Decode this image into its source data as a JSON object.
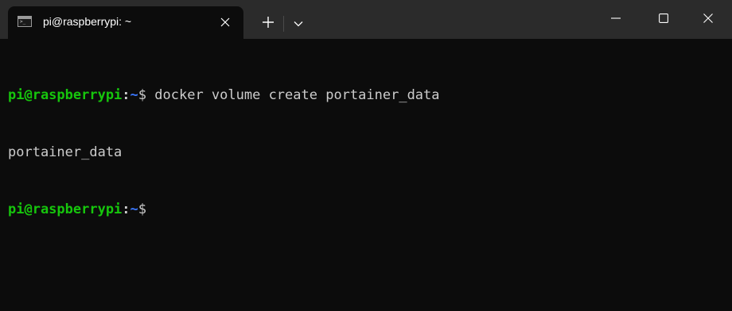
{
  "window": {
    "tab_title": "pi@raspberrypi: ~",
    "tab_icon_text": ">_"
  },
  "icons": {
    "tab": "terminal-icon",
    "tab_close": "close-icon",
    "new_tab": "plus-icon",
    "dropdown": "chevron-down-icon",
    "minimize": "minimize-icon",
    "maximize": "maximize-icon",
    "close": "close-icon"
  },
  "colors": {
    "background": "#0c0c0c",
    "titlebar": "#2b2b2b",
    "prompt_user": "#16c60c",
    "prompt_path": "#3b78ff",
    "text": "#cccccc"
  },
  "terminal": {
    "lines": [
      {
        "user": "pi@raspberrypi",
        "colon": ":",
        "path": "~",
        "dollar": "$",
        "command": " docker volume create portainer_data"
      },
      {
        "output": "portainer_data"
      },
      {
        "user": "pi@raspberrypi",
        "colon": ":",
        "path": "~",
        "dollar": "$",
        "command": ""
      }
    ]
  }
}
